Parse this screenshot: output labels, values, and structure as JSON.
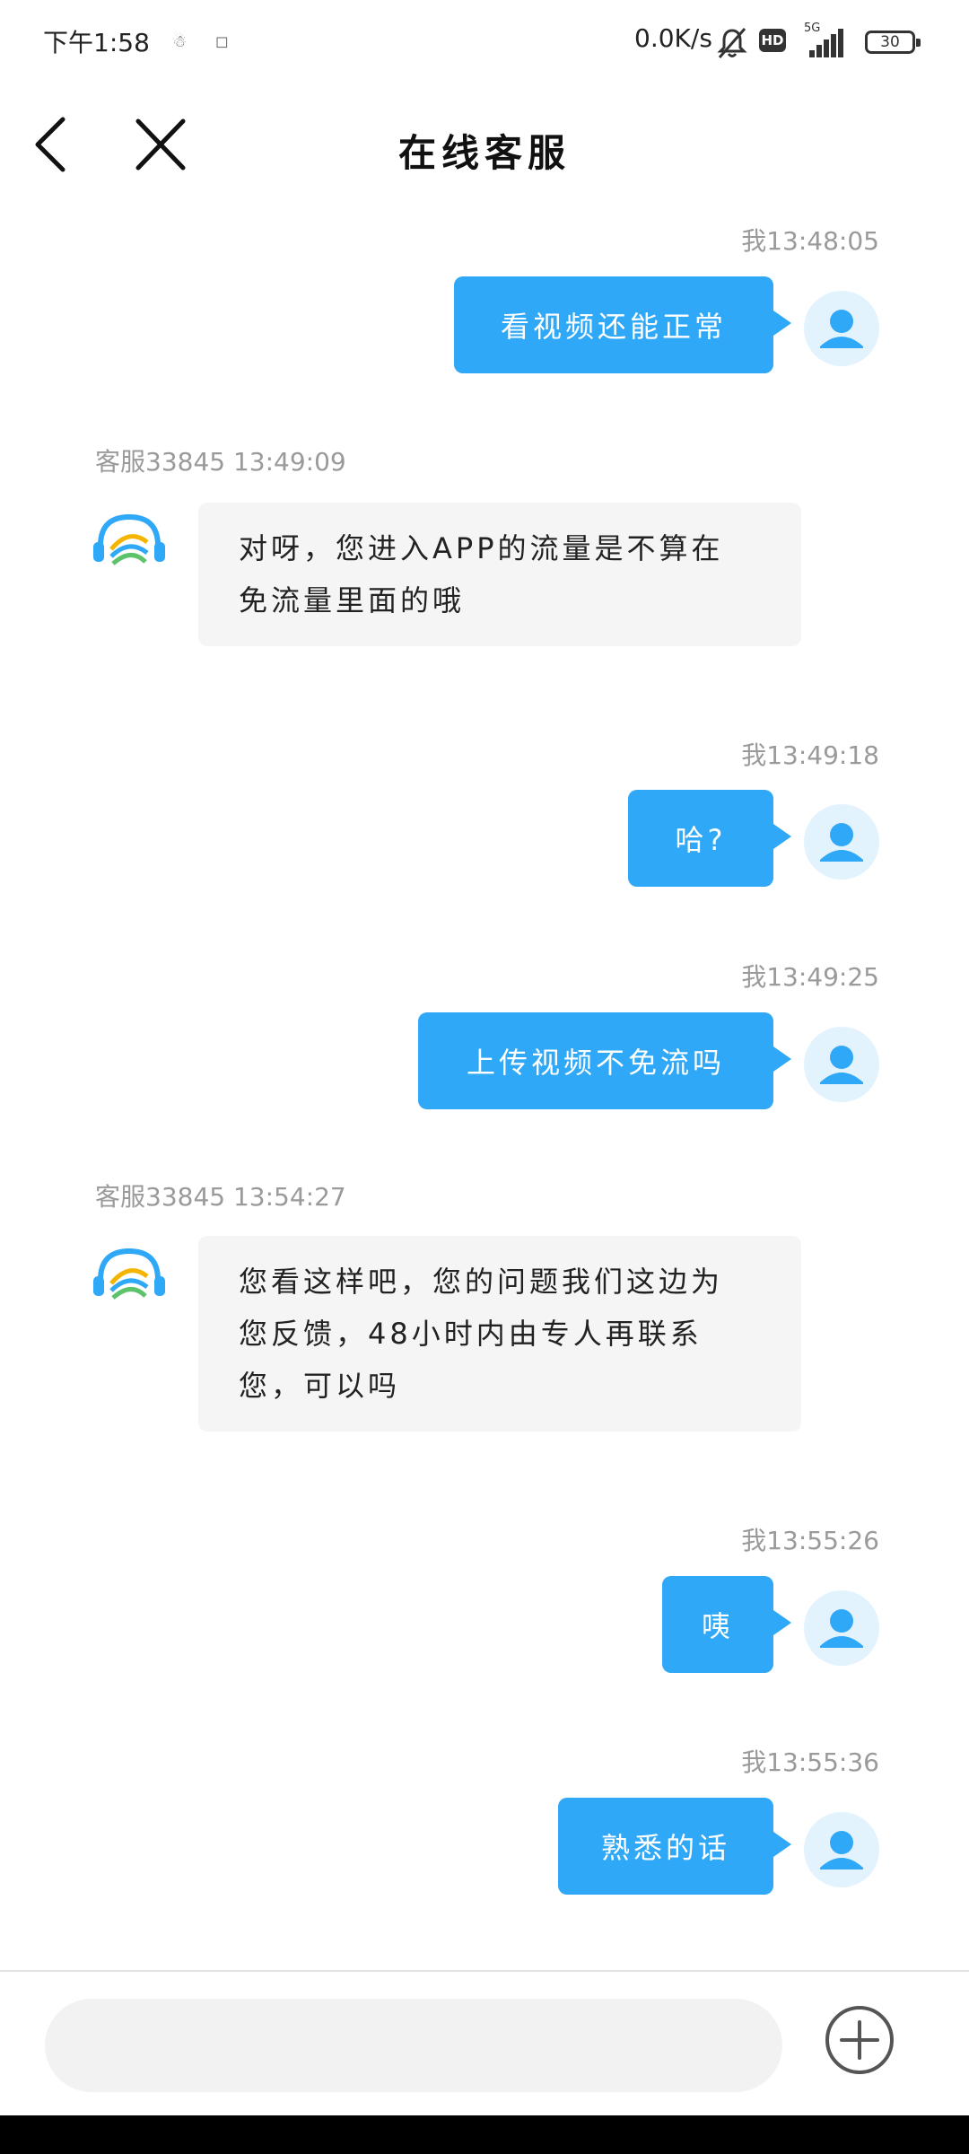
{
  "status_bar": {
    "time": "下午1:58",
    "mini_icon_1": "☃",
    "mini_icon_2": "◻",
    "network_speed": "0.0K/s",
    "hd": "HD",
    "network_type": "5G",
    "battery": "30"
  },
  "header": {
    "title": "在线客服"
  },
  "messages": [
    {
      "sender": "user",
      "timestamp": "我13:48:05",
      "text": "看视频还能正常"
    },
    {
      "sender": "agent",
      "timestamp": "客服33845 13:49:09",
      "lines": [
        "对呀，您进入APP的流量是不算在",
        "免流量里面的哦"
      ]
    },
    {
      "sender": "user",
      "timestamp": "我13:49:18",
      "text": "哈?"
    },
    {
      "sender": "user",
      "timestamp": "我13:49:25",
      "text": "上传视频不免流吗"
    },
    {
      "sender": "agent",
      "timestamp": "客服33845 13:54:27",
      "lines": [
        "您看这样吧，您的问题我们这边为",
        "您反馈，48小时内由专人再联系",
        "您，可以吗"
      ]
    },
    {
      "sender": "user",
      "timestamp": "我13:55:26",
      "text": "咦"
    },
    {
      "sender": "user",
      "timestamp": "我13:55:36",
      "text": "熟悉的话"
    }
  ],
  "input": {
    "placeholder": ""
  },
  "colors": {
    "user_bubble": "#2fa8f7",
    "agent_bubble": "#f5f5f5",
    "timestamp": "#9a9a9a",
    "avatar_bg": "#e3f3fd"
  }
}
